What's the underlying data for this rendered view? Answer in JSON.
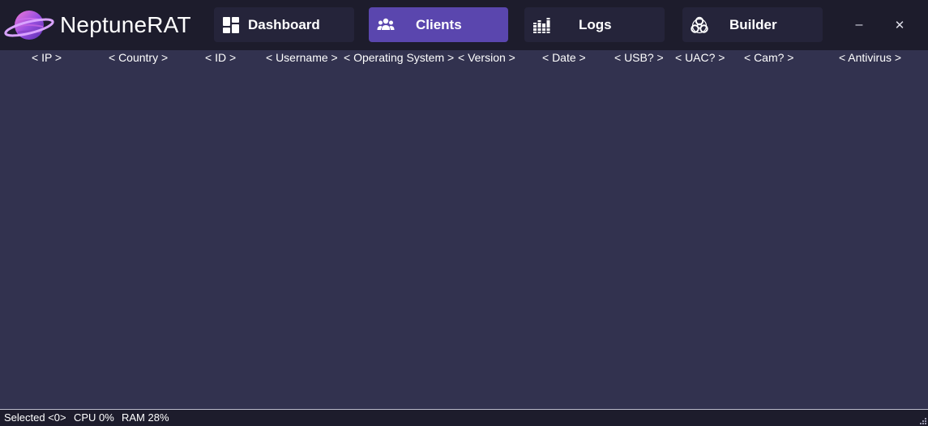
{
  "app": {
    "title": "NeptuneRAT"
  },
  "nav": {
    "dashboard": "Dashboard",
    "clients": "Clients",
    "logs": "Logs",
    "builder": "Builder"
  },
  "window": {
    "minimize": "–",
    "close": "✕"
  },
  "table": {
    "columns": [
      "< IP >",
      "< Country >",
      "< ID >",
      "< Username >",
      "< Operating System >",
      "< Version >",
      "< Date >",
      "< USB? >",
      "< UAC? >",
      "< Cam? >",
      "< Antivirus >"
    ]
  },
  "status": {
    "selected": "Selected <0>",
    "cpu": "CPU 0%",
    "ram": "RAM 28%"
  },
  "colors": {
    "background": "#32324f",
    "titlebar": "#1d1c2c",
    "nav_button": "#25243a",
    "nav_active": "#5a46ae"
  }
}
